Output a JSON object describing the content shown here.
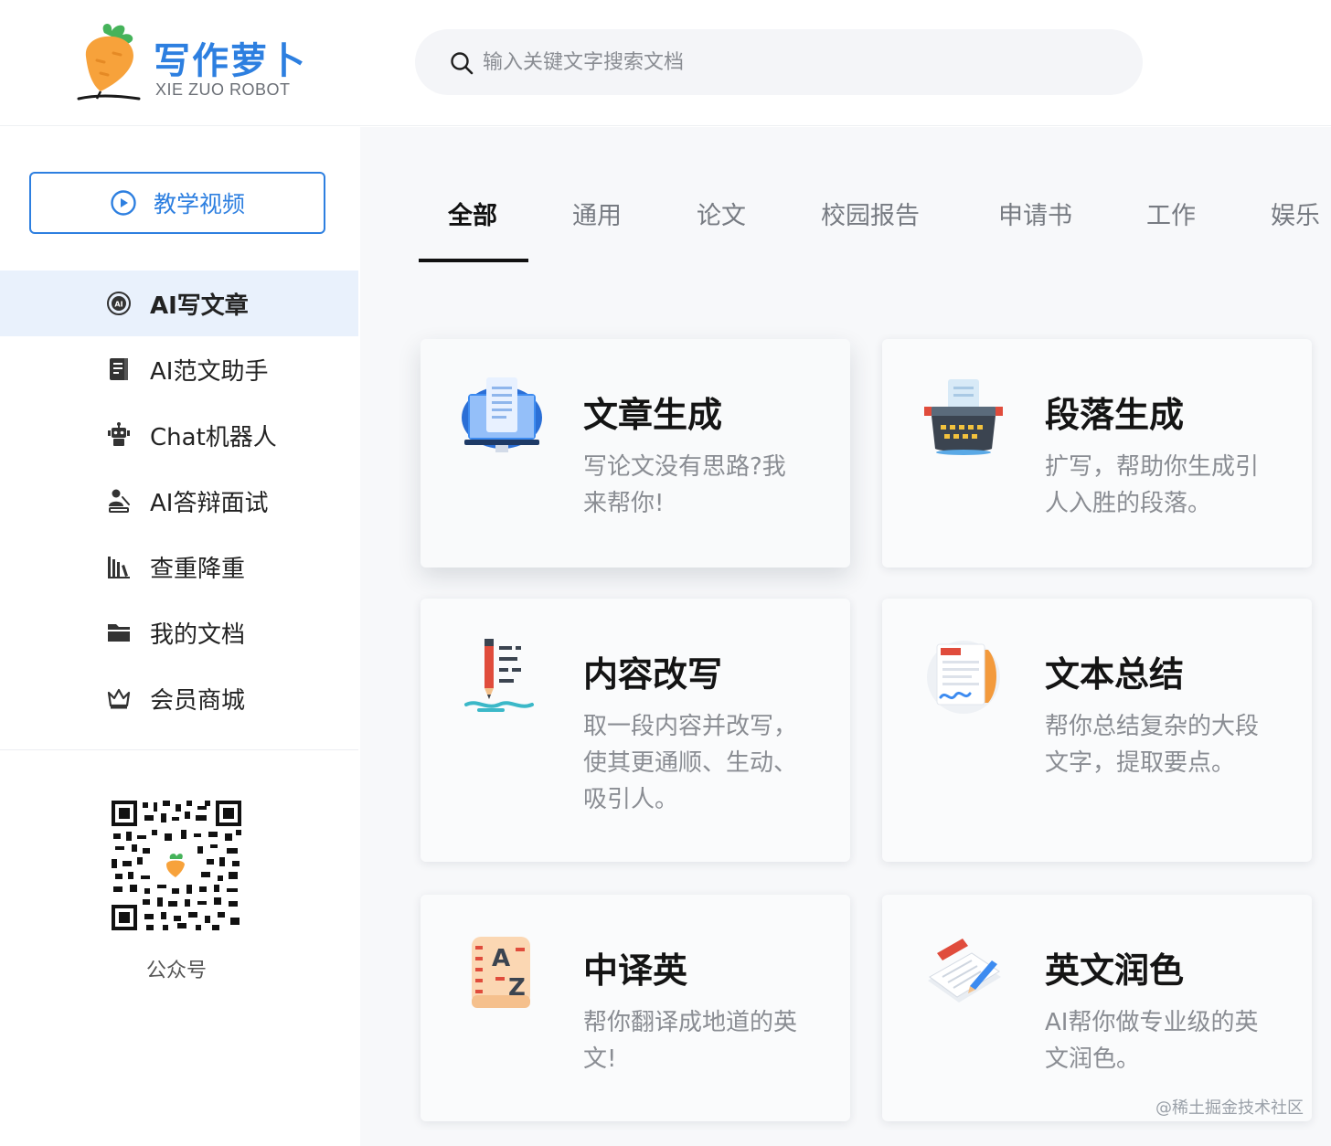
{
  "header": {
    "logo_title": "写作萝卜",
    "logo_subtitle": "XIE ZUO ROBOT",
    "search_placeholder": "输入关键文字搜索文档"
  },
  "sidebar": {
    "video_button": "教学视频",
    "items": [
      {
        "label": "AI写文章",
        "icon": "ai-badge-icon",
        "active": true
      },
      {
        "label": "AI范文助手",
        "icon": "document-icon",
        "active": false
      },
      {
        "label": "Chat机器人",
        "icon": "robot-icon",
        "active": false
      },
      {
        "label": "AI答辩面试",
        "icon": "presenter-icon",
        "active": false
      },
      {
        "label": "查重降重",
        "icon": "library-icon",
        "active": false
      },
      {
        "label": "我的文档",
        "icon": "folder-icon",
        "active": false
      },
      {
        "label": "会员商城",
        "icon": "crown-icon",
        "active": false
      }
    ],
    "qr_label": "公众号"
  },
  "tabs": [
    "全部",
    "通用",
    "论文",
    "校园报告",
    "申请书",
    "工作",
    "娱乐"
  ],
  "active_tab": 0,
  "cards": [
    {
      "title": "文章生成",
      "desc": "写论文没有思路?我来帮你!",
      "icon": "monitor-document-icon"
    },
    {
      "title": "段落生成",
      "desc": "扩写，帮助你生成引人入胜的段落。",
      "icon": "typewriter-icon"
    },
    {
      "title": "内容改写",
      "desc": "取一段内容并改写，使其更通顺、生动、吸引人。",
      "icon": "pen-rewrite-icon"
    },
    {
      "title": "文本总结",
      "desc": "帮你总结复杂的大段文字，提取要点。",
      "icon": "summary-paper-icon"
    },
    {
      "title": "中译英",
      "desc": "帮你翻译成地道的英文!",
      "icon": "translate-az-icon"
    },
    {
      "title": "英文润色",
      "desc": "AI帮你做专业级的英文润色。",
      "icon": "article-pen-icon"
    }
  ],
  "watermark": "@稀土掘金技术社区",
  "colors": {
    "brand": "#2d7fe0",
    "active_bg": "#e9f1fc",
    "main_bg": "#f7f8fa"
  }
}
